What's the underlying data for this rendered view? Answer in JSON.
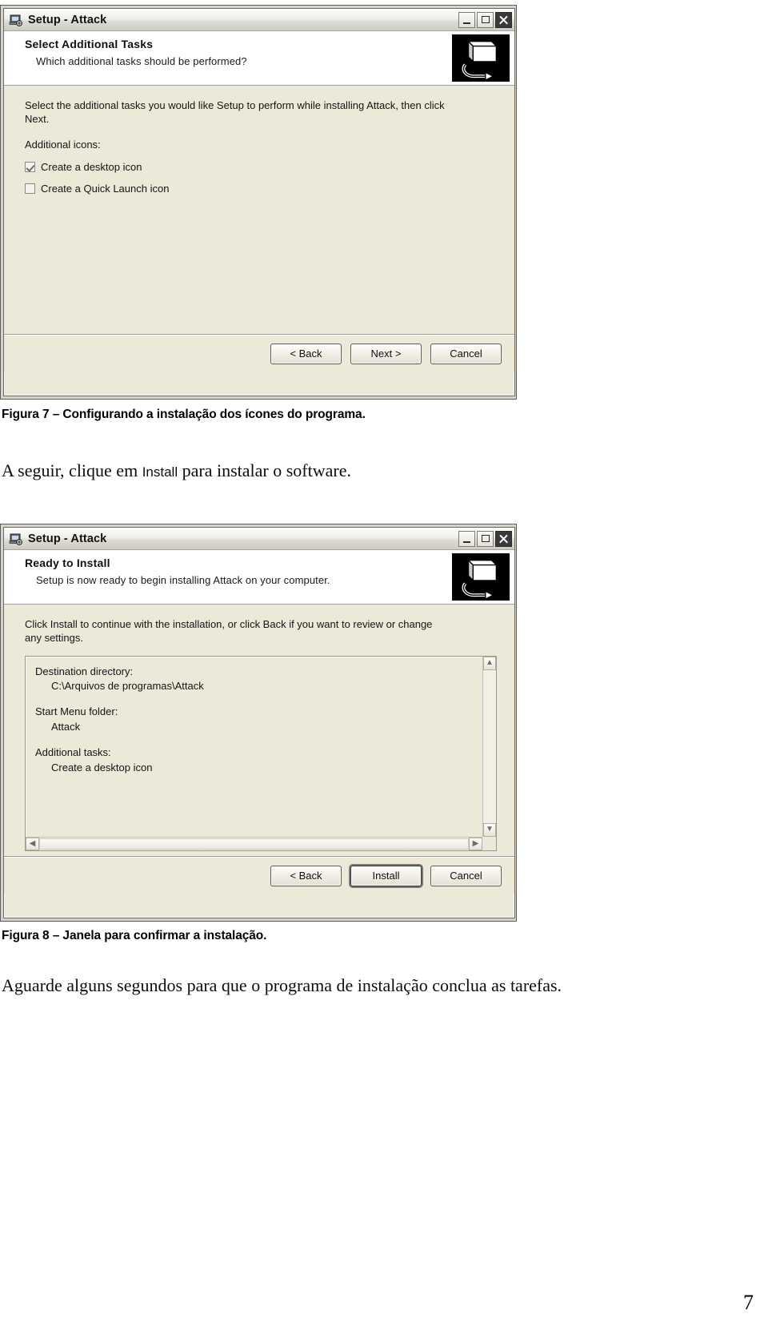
{
  "document": {
    "page_number": "7",
    "figure7_caption": "Figura 7 – Configurando a instalação dos ícones do programa.",
    "paragraph1_before": "A seguir, clique em ",
    "paragraph1_emphasis": "Install",
    "paragraph1_after": " para instalar o software.",
    "figure8_caption": "Figura 8 – Janela para confirmar a instalação.",
    "paragraph2": "Aguarde alguns segundos para que o programa de instalação conclua as tarefas."
  },
  "dialog1": {
    "titlebar": {
      "title": "Setup - Attack",
      "minimize_icon": "minimize-icon",
      "maximize_icon": "maximize-icon",
      "close_icon": "close-icon",
      "app_icon": "setup-installer-icon"
    },
    "header": {
      "title": "Select Additional Tasks",
      "subtitle": "Which additional tasks should be performed?",
      "artwork_icon": "installer-computer-icon"
    },
    "body": {
      "intro": "Select the additional tasks you would like Setup to perform while installing Attack, then click Next.",
      "group_label": "Additional icons:",
      "checkboxes": [
        {
          "label": "Create a desktop icon",
          "checked": true
        },
        {
          "label": "Create a Quick Launch icon",
          "checked": false
        }
      ]
    },
    "buttons": [
      {
        "label": "< Back",
        "default": false
      },
      {
        "label": "Next >",
        "default": false
      },
      {
        "label": "Cancel",
        "default": false
      }
    ]
  },
  "dialog2": {
    "titlebar": {
      "title": "Setup - Attack",
      "minimize_icon": "minimize-icon",
      "maximize_icon": "maximize-icon",
      "close_icon": "close-icon",
      "app_icon": "setup-installer-icon"
    },
    "header": {
      "title": "Ready to Install",
      "subtitle": "Setup is now ready to begin installing Attack on your computer.",
      "artwork_icon": "installer-computer-icon"
    },
    "body": {
      "intro": "Click Install to continue with the installation, or click Back if you want to review or change any settings.",
      "summary": [
        {
          "heading": "Destination directory:",
          "value": "C:\\Arquivos de programas\\Attack"
        },
        {
          "heading": "Start Menu folder:",
          "value": "Attack"
        },
        {
          "heading": "Additional tasks:",
          "value": "Create a desktop icon"
        }
      ],
      "scroll_up_glyph": "▲",
      "scroll_down_glyph": "▼",
      "scroll_left_glyph": "◀",
      "scroll_right_glyph": "▶"
    },
    "buttons": [
      {
        "label": "< Back",
        "default": false
      },
      {
        "label": "Install",
        "default": true
      },
      {
        "label": "Cancel",
        "default": false
      }
    ]
  }
}
